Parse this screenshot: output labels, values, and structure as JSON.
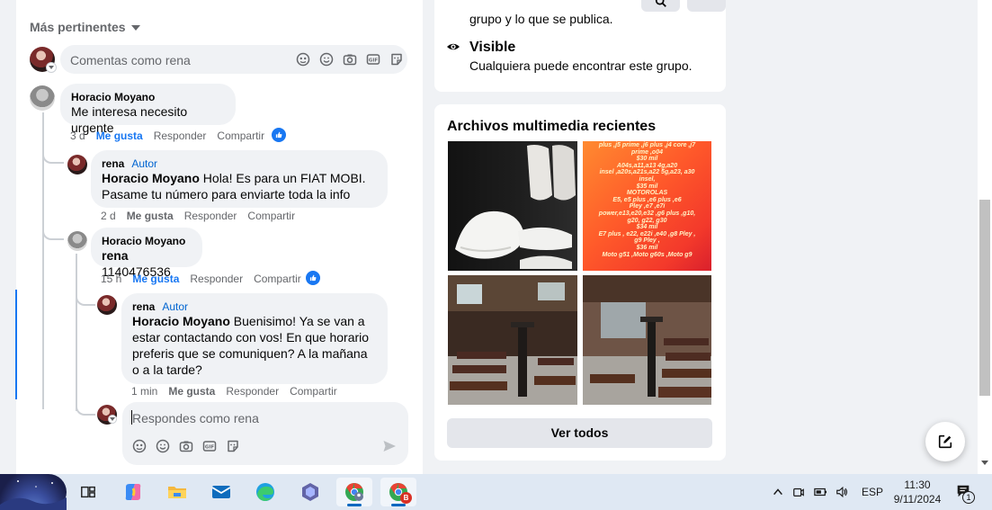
{
  "feed": {
    "sort_label": "Más pertinentes",
    "comment_placeholder": "Comentas como rena",
    "comments": [
      {
        "author": "Horacio Moyano",
        "text": "Me interesa necesito urgente",
        "time": "3 d",
        "like": "Me gusta",
        "reply": "Responder",
        "share": "Compartir"
      },
      {
        "author": "rena",
        "badge": "Autor",
        "mention": "Horacio Moyano",
        "text": " Hola! Es para un FIAT MOBI. Pasame tu número para enviarte toda la info",
        "time": "2 d",
        "like": "Me gusta",
        "reply": "Responder",
        "share": "Compartir"
      },
      {
        "author": "Horacio Moyano",
        "mention": "rena",
        "text": " 1140476536",
        "time": "15 h",
        "like": "Me gusta",
        "reply": "Responder",
        "share": "Compartir"
      },
      {
        "author": "rena",
        "badge": "Autor",
        "mention": "Horacio Moyano",
        "text": " Buenisimo! Ya se van a estar contactando con vos! En que horario preferis que se comuniquen? A la mañana o a la tarde?",
        "time": "1 min",
        "like": "Me gusta",
        "reply": "Responder",
        "share": "Compartir"
      }
    ],
    "reply_placeholder": "Respondes como rena"
  },
  "about": {
    "top_text": "grupo y lo que se publica.",
    "visible_title": "Visible",
    "visible_desc": "Cualquiera puede encontrar este grupo."
  },
  "media": {
    "title": "Archivos multimedia recientes",
    "promo_lines": [
      "plus ,j5 prime ,j6 plus ,j4 core ,j7",
      "prime ,o04",
      "$30 mil",
      "A04s,a11,a13 4g,a20",
      "insel ,a20s,a21s,a22 5g,a23, a30",
      "insel,",
      "$35 mil",
      "MOTOROLAS",
      "E5, e5 plus ,e6 plus ,e6",
      "Pley ,e7 ,e7i",
      "power,e13,e20,e32 ,g6 plus ,g10,",
      "g20, g22, g30",
      "$34 mil",
      "E7 plus , e22, e22i ,e40 ,g8 Pley ,",
      "g9 Pley ,",
      "$36 mil",
      "Moto g51 ,Moto g60s ,Moto g9"
    ],
    "see_all": "Ver todos"
  },
  "taskbar": {
    "lang": "ESP",
    "time": "11:30",
    "date": "9/11/2024",
    "notification_count": "1",
    "chrome_badge": "B"
  },
  "colors": {
    "accent": "#1877f2",
    "author_badge": "#0064d1",
    "promo_bg": "#ff5a2a"
  }
}
